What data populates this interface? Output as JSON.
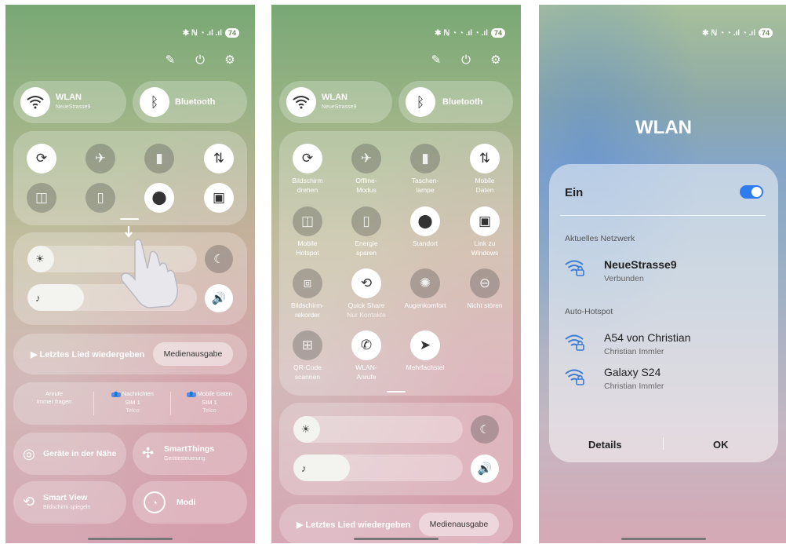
{
  "panel1": {
    "status": {
      "icons": "✱ ℕ ◔ .ıl .ıl",
      "battery": "74"
    },
    "wlan": {
      "title": "WLAN",
      "network": "NeueStrasse9"
    },
    "bluetooth": {
      "title": "Bluetooth"
    },
    "media": {
      "play_label": "▶ Letztes Lied wiedergeben",
      "output_label": "Medienausgabe"
    },
    "sims": [
      {
        "title": "Anrufe",
        "line1": "Immer fragen",
        "line2": ""
      },
      {
        "title": "Nachrichten",
        "line1": "SIM 1",
        "line2": "Telco"
      },
      {
        "title": "Mobile Daten",
        "line1": "SIM 1",
        "line2": "Telco"
      }
    ],
    "nearby": {
      "title": "Geräte in der Nähe"
    },
    "smartthings": {
      "title": "SmartThings",
      "sub": "Gerätesteuerung"
    },
    "smartview": {
      "title": "Smart View",
      "sub": "Bildschirm spiegeln"
    },
    "modi": {
      "title": "Modi"
    }
  },
  "panel2": {
    "status": {
      "icons": "✱ ℕ ◔ ◔ .ıl ◔ .ıl",
      "battery": "74"
    },
    "wlan": {
      "title": "WLAN",
      "network": "NeueStrasse9"
    },
    "bluetooth": {
      "title": "Bluetooth"
    },
    "tiles": [
      {
        "l1": "Bildschirm",
        "l2": "drehen",
        "sub": ""
      },
      {
        "l1": "Offline-",
        "l2": "Modus",
        "sub": ""
      },
      {
        "l1": "Taschen-",
        "l2": "lampe",
        "sub": ""
      },
      {
        "l1": "Mobile",
        "l2": "Daten",
        "sub": ""
      },
      {
        "l1": "Mobile",
        "l2": "Hotspot",
        "sub": ""
      },
      {
        "l1": "Energie",
        "l2": "sparen",
        "sub": ""
      },
      {
        "l1": "Standort",
        "l2": "",
        "sub": ""
      },
      {
        "l1": "Link zu",
        "l2": "Windows",
        "sub": ""
      },
      {
        "l1": "Bildschirm-",
        "l2": "rekorder",
        "sub": ""
      },
      {
        "l1": "Quick Share",
        "l2": "",
        "sub": "Nur Kontakte"
      },
      {
        "l1": "Augenkomfort",
        "l2": "",
        "sub": ""
      },
      {
        "l1": "Nicht stören",
        "l2": "",
        "sub": ""
      },
      {
        "l1": "QR-Code",
        "l2": "scannen",
        "sub": ""
      },
      {
        "l1": "WLAN-",
        "l2": "Anrufe",
        "sub": ""
      },
      {
        "l1": "Mehrfachstel",
        "l2": "",
        "sub": ""
      }
    ],
    "media": {
      "play_label": "▶ Letztes Lied wiedergeben",
      "output_label": "Medienausgabe"
    }
  },
  "panel3": {
    "status": {
      "icons": "✱ ℕ ◔ ◔ .ıl ◔ .ıl",
      "battery": "74"
    },
    "title": "WLAN",
    "toggle_label": "Ein",
    "toggle_on": true,
    "current_header": "Aktuelles Netzwerk",
    "current": {
      "name": "NeueStrasse9",
      "status": "Verbunden"
    },
    "hotspot_header": "Auto-Hotspot",
    "hotspots": [
      {
        "name": "A54 von Christian",
        "owner": "Christian Immler"
      },
      {
        "name": "Galaxy S24",
        "owner": "Christian Immler"
      }
    ],
    "details_label": "Details",
    "ok_label": "OK"
  },
  "colors": {
    "accent": "#3a7bd5",
    "toggle": "#2f7cf0"
  }
}
